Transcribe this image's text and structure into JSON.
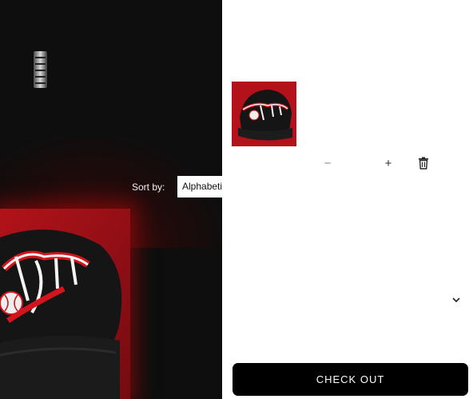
{
  "store": {
    "sort_label": "Sort by:",
    "sort_value": "Alphabetically, A-Z",
    "logo_icon": "brand-logo-icon",
    "product_image_alt": "black cap with red embroidery"
  },
  "cart": {
    "item": {
      "thumbnail_icon": "cap-thumbnail",
      "decrease_symbol": "−",
      "increase_symbol": "+"
    },
    "icons": {
      "remove": "trash-icon",
      "expand": "chevron-down-icon"
    },
    "checkout_label": "CHECK OUT"
  },
  "colors": {
    "accent_red": "#b3121a",
    "cap_black": "#141414",
    "button_black": "#000000"
  }
}
